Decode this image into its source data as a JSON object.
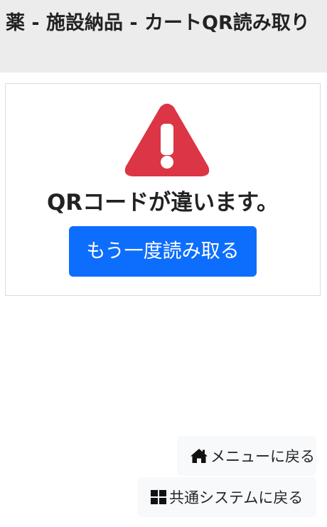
{
  "header": {
    "title": "薬 - 施設納品 - カートQR読み取り"
  },
  "alert": {
    "icon": "warning-triangle-icon",
    "icon_color": "#dc3545",
    "message": "QRコードが違います。",
    "retry_label": "もう一度読み取る",
    "retry_color": "#0d6efd"
  },
  "footer": {
    "menu_icon": "home-icon",
    "menu_label": "メニューに戻る",
    "common_icon": "windows-grid-icon",
    "common_label": "共通システムに戻る"
  }
}
